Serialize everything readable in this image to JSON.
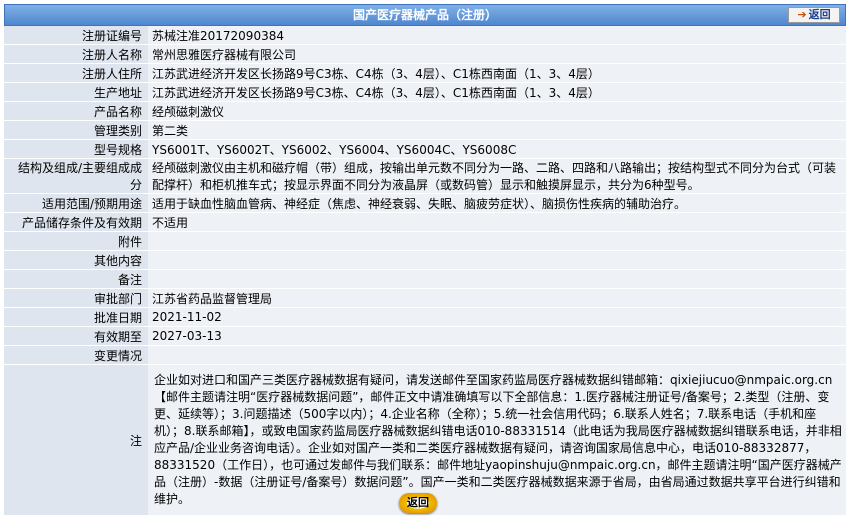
{
  "header": {
    "title": "国产医疗器械产品（注册）",
    "back_label": "返回"
  },
  "rows": [
    {
      "label": "注册证编号",
      "value": "苏械注准20172090384"
    },
    {
      "label": "注册人名称",
      "value": "常州思雅医疗器械有限公司"
    },
    {
      "label": "注册人住所",
      "value": "江苏武进经济开发区长扬路9号C3栋、C4栋（3、4层）、C1栋西南面（1、3、4层）"
    },
    {
      "label": "生产地址",
      "value": "江苏武进经济开发区长扬路9号C3栋、C4栋（3、4层）、C1栋西南面（1、3、4层）"
    },
    {
      "label": "产品名称",
      "value": "经颅磁刺激仪"
    },
    {
      "label": "管理类别",
      "value": "第二类"
    },
    {
      "label": "型号规格",
      "value": "YS6001T、YS6002T、YS6002、YS6004、YS6004C、YS6008C"
    },
    {
      "label": "结构及组成/主要组成成分",
      "value": "经颅磁刺激仪由主机和磁疗帽（带）组成，按输出单元数不同分为一路、二路、四路和八路输出；按结构型式不同分为台式（可装配撑杆）和柜机推车式；按显示界面不同分为液晶屏（或数码管）显示和触摸屏显示，共分为6种型号。"
    },
    {
      "label": "适用范围/预期用途",
      "value": "适用于缺血性脑血管病、神经症（焦虑、神经衰弱、失眠、脑疲劳症状）、脑损伤性疾病的辅助治疗。"
    },
    {
      "label": "产品储存条件及有效期",
      "value": "不适用"
    },
    {
      "label": "附件",
      "value": ""
    },
    {
      "label": "其他内容",
      "value": ""
    },
    {
      "label": "备注",
      "value": ""
    },
    {
      "label": "审批部门",
      "value": "江苏省药品监督管理局"
    },
    {
      "label": "批准日期",
      "value": "2021-11-02"
    },
    {
      "label": "有效期至",
      "value": "2027-03-13"
    },
    {
      "label": "变更情况",
      "value": ""
    }
  ],
  "note": {
    "label": "注",
    "text": "企业如对进口和国产三类医疗器械数据有疑问，请发送邮件至国家药监局医疗器械数据纠错邮箱：qixiejiucuo@nmpaic.org.cn【邮件主题请注明“医疗器械数据问题”，邮件正文中请准确填写以下全部信息：1.医疗器械注册证号/备案号；2.类型（注册、变更、延续等）；3.问题描述（500字以内）；4.企业名称（全称）；5.统一社会信用代码；6.联系人姓名；7.联系电话（手机和座机）；8.联系邮箱】，或致电国家药监局医疗器械数据纠错电话010-88331514（此电话为我局医疗器械数据纠错联系电话，并非相应产品/企业业务咨询电话）。企业如对国产一类和二类医疗器械数据有疑问，请咨询国家局信息中心，电话010-88332877，88331520（工作日），也可通过发邮件与我们联系：邮件地址yaopinshuju@nmpaic.org.cn，邮件主题请注明“国产医疗器械产品（注册）-数据（注册证号/备案号）数据问题”。国产一类和二类医疗器械数据来源于省局，由省局通过数据共享平台进行纠错和维护。"
  },
  "footer": {
    "back_label": "返回"
  }
}
